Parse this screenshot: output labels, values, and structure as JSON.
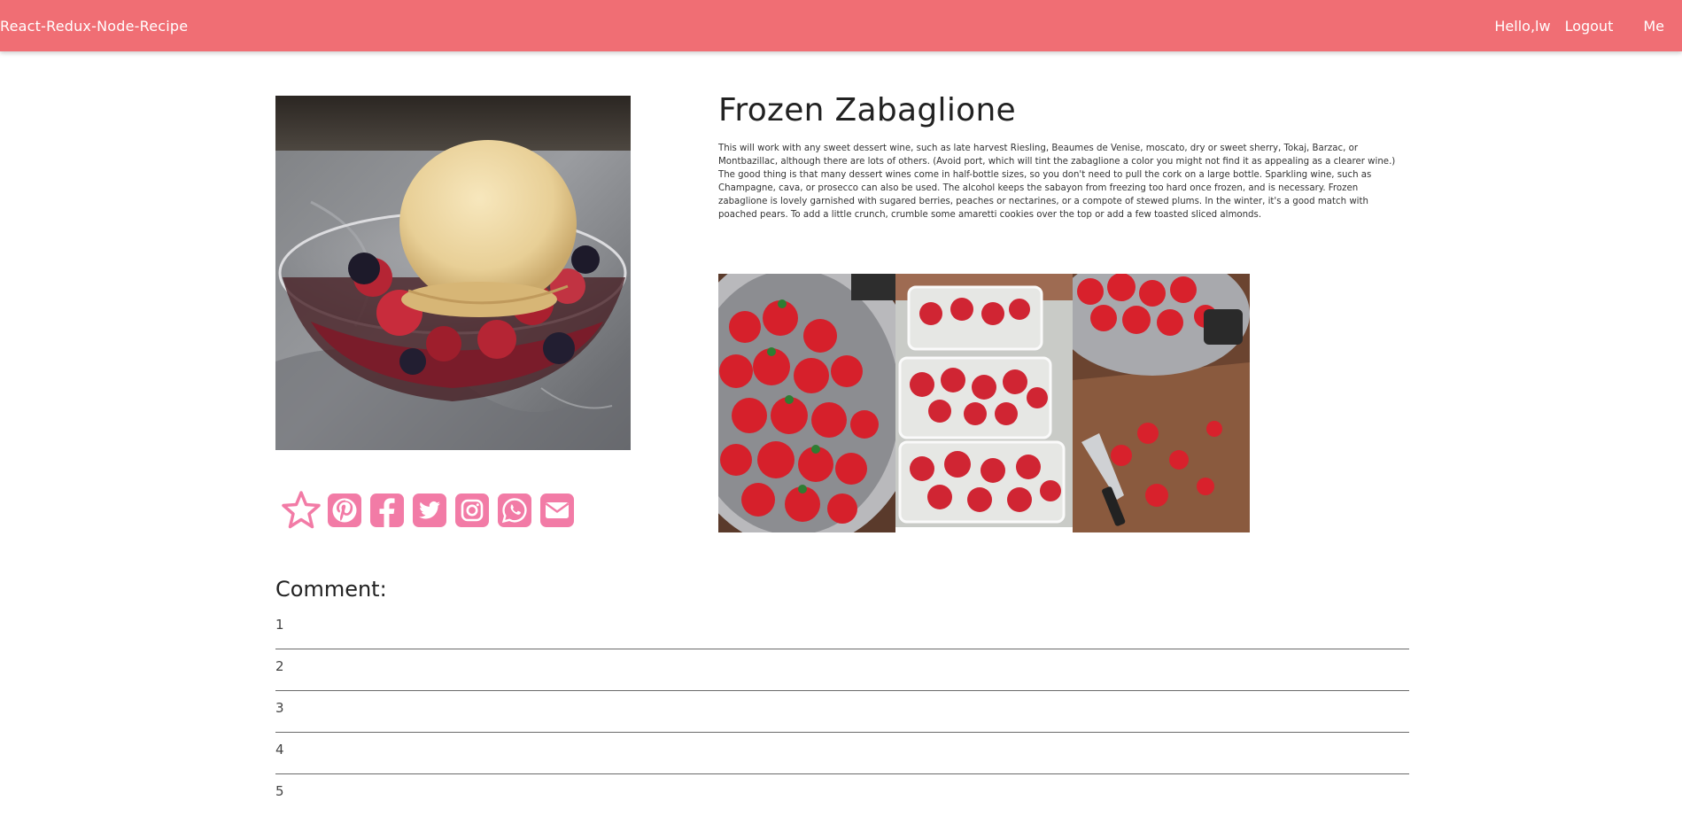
{
  "navbar": {
    "brand": "React-Redux-Node-Recipe",
    "greeting": "Hello,lw",
    "logout": "Logout",
    "me": "Me",
    "color": "#f06e74"
  },
  "recipe": {
    "title": "Frozen Zabaglione",
    "description": "This will work with any sweet dessert wine, such as late harvest Riesling, Beaumes de Venise, moscato, dry or sweet sherry, Tokaj, Barzac, or Montbazillac, although there are lots of others. (Avoid port, which will tint the zabaglione a color you might not find it as appealing as a clearer wine.) The good thing is that many dessert wines come in half-bottle sizes, so you don't need to pull the cork on a large bottle. Sparkling wine, such as Champagne, cava, or prosecco can also be used. The alcohol keeps the sabayon from freezing too hard once frozen, and is necessary. Frozen zabaglione is lovely garnished with sugared berries, peaches or nectarines, or a compote of stewed plums. In the winter, it's a good match with poached pears. To add a little crunch, crumble some amaretti cookies over the top or add a few toasted sliced almonds."
  },
  "social": {
    "icons": [
      "star-icon",
      "pinterest-icon",
      "facebook-icon",
      "twitter-icon",
      "instagram-icon",
      "whatsapp-icon",
      "envelope-icon"
    ],
    "color": "#f27ba6"
  },
  "comments": {
    "heading": "Comment:",
    "items": [
      "1",
      "2",
      "3",
      "4",
      "5"
    ]
  }
}
